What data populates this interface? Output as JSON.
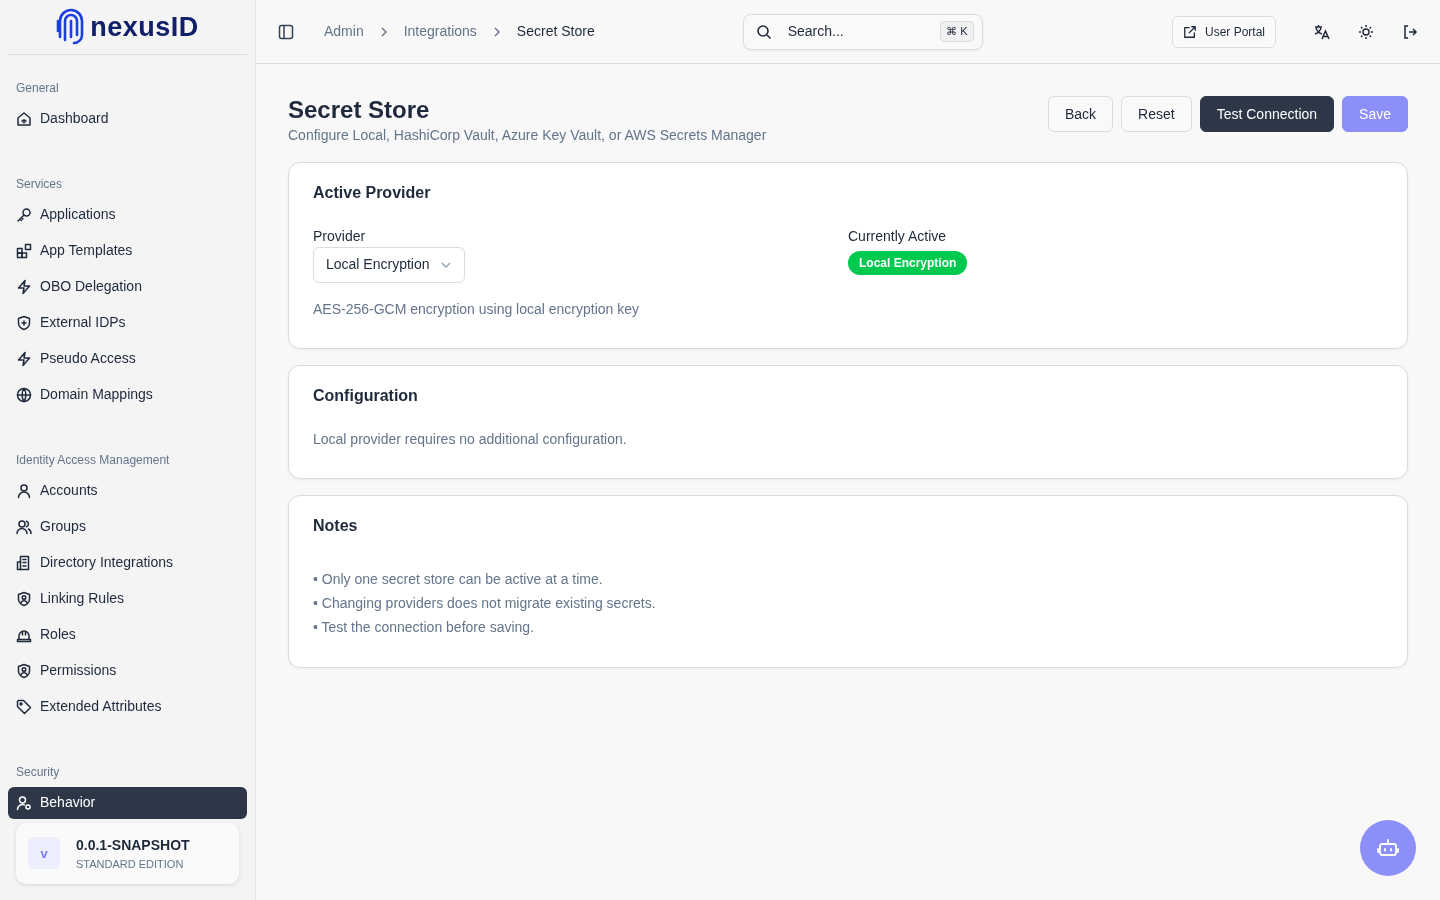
{
  "brand": {
    "name": "nexusID"
  },
  "sidebar": {
    "groups": [
      {
        "title": "General",
        "items": [
          {
            "label": "Dashboard",
            "selected": false
          }
        ]
      },
      {
        "title": "Services",
        "items": [
          {
            "label": "Applications",
            "selected": false
          },
          {
            "label": "App Templates",
            "selected": false
          },
          {
            "label": "OBO Delegation",
            "selected": false
          },
          {
            "label": "External IDPs",
            "selected": false
          },
          {
            "label": "Pseudo Access",
            "selected": false
          },
          {
            "label": "Domain Mappings",
            "selected": false
          }
        ]
      },
      {
        "title": "Identity Access Management",
        "items": [
          {
            "label": "Accounts",
            "selected": false
          },
          {
            "label": "Groups",
            "selected": false
          },
          {
            "label": "Directory Integrations",
            "selected": false
          },
          {
            "label": "Linking Rules",
            "selected": false
          },
          {
            "label": "Roles",
            "selected": false
          },
          {
            "label": "Permissions",
            "selected": false
          },
          {
            "label": "Extended Attributes",
            "selected": false
          }
        ]
      },
      {
        "title": "Security",
        "items": [
          {
            "label": "Behavior",
            "selected": true
          }
        ]
      }
    ],
    "version": {
      "avatar": "v",
      "version": "0.0.1-SNAPSHOT",
      "edition": "STANDARD EDITION"
    }
  },
  "breadcrumb": [
    "Admin",
    "Integrations",
    "Secret Store"
  ],
  "search": {
    "placeholder": "Search...",
    "shortcut": "⌘ K"
  },
  "header_actions": {
    "user_portal": "User Portal"
  },
  "page": {
    "title": "Secret Store",
    "subtitle": "Configure Local, HashiCorp Vault, Azure Key Vault, or AWS Secrets Manager",
    "buttons": [
      {
        "label": "Back",
        "kind": "outline"
      },
      {
        "label": "Reset",
        "kind": "outline"
      },
      {
        "label": "Test Connection",
        "kind": "dark"
      },
      {
        "label": "Save",
        "kind": "primary"
      }
    ]
  },
  "active_provider": {
    "title": "Active Provider",
    "provider_label": "Provider",
    "provider_value": "Local Encryption",
    "description": "AES-256-GCM encryption using local encryption key",
    "current_label": "Currently Active",
    "current_badge": "Local Encryption"
  },
  "configuration": {
    "title": "Configuration",
    "text": "Local provider requires no additional configuration."
  },
  "notes": {
    "title": "Notes",
    "items": [
      "• Only one secret store can be active at a time.",
      "• Changing providers does not migrate existing secrets.",
      "• Test the connection before saving."
    ]
  }
}
